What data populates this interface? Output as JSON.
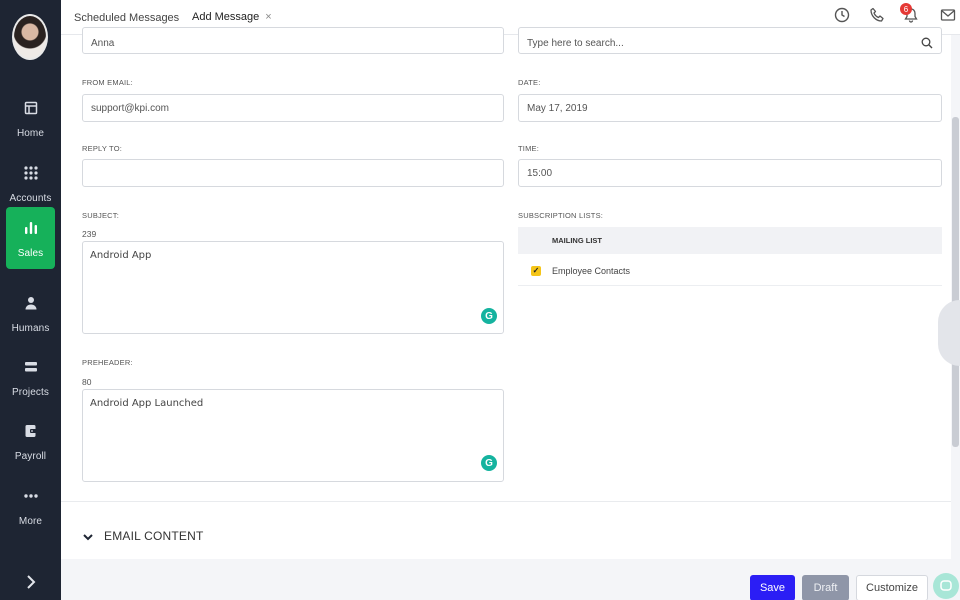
{
  "sidebar": {
    "items": [
      {
        "label": "Home",
        "icon": "home-icon"
      },
      {
        "label": "Accounts",
        "icon": "grid-icon"
      },
      {
        "label": "Sales",
        "icon": "bar-chart-icon"
      },
      {
        "label": "Humans",
        "icon": "person-icon"
      },
      {
        "label": "Projects",
        "icon": "stack-icon"
      },
      {
        "label": "Payroll",
        "icon": "wallet-icon"
      },
      {
        "label": "More",
        "icon": "dots-icon"
      }
    ],
    "active_item": "Sales",
    "active_color": "#16b15a"
  },
  "tabs": [
    {
      "label": "Scheduled Messages"
    },
    {
      "label": "Add Message",
      "close": "×"
    }
  ],
  "header": {
    "notification_count": "6"
  },
  "form": {
    "from_name_value": "Anna",
    "from_email_label": "FROM EMAIL:",
    "from_email_value": "support@kpi.com",
    "reply_to_label": "REPLY TO:",
    "reply_to_value": "",
    "subject_label": "SUBJECT:",
    "subject_counter": "239",
    "subject_value": "Android App",
    "preheader_label": "PREHEADER:",
    "preheader_counter": "80",
    "preheader_value": "Android App Launched",
    "search_placeholder": "Type here to search...",
    "date_label": "DATE:",
    "date_value": "May 17, 2019",
    "time_label": "TIME:",
    "time_value": "15:00",
    "subscription_label": "SUBSCRIPTION LISTS:",
    "mailing_list_header": "MAILING LIST",
    "mailing_list_items": [
      {
        "label": "Employee Contacts",
        "checked": true
      }
    ]
  },
  "email_content_section": "EMAIL CONTENT",
  "footer": {
    "save_label": "Save",
    "draft_label": "Draft",
    "customize_label": "Customize",
    "save_color": "#2b1ef5"
  }
}
